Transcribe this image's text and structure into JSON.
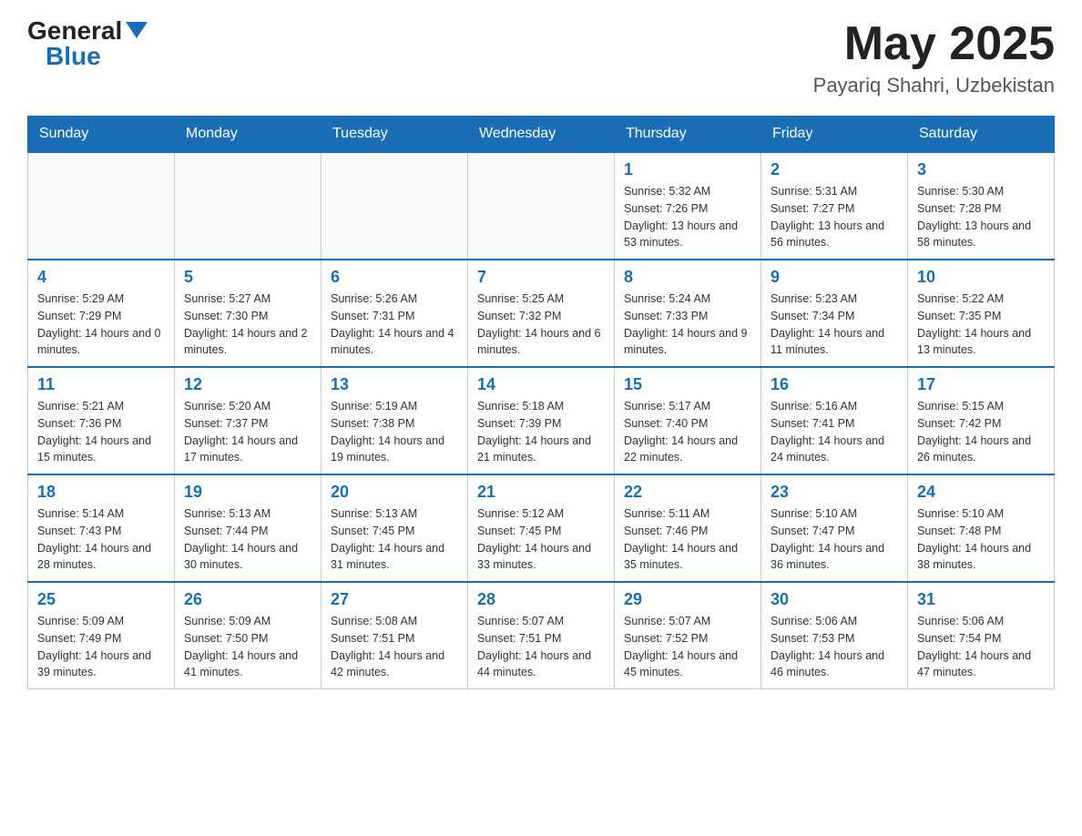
{
  "header": {
    "logo_general": "General",
    "logo_blue": "Blue",
    "month": "May 2025",
    "location": "Payariq Shahri, Uzbekistan"
  },
  "weekdays": [
    "Sunday",
    "Monday",
    "Tuesday",
    "Wednesday",
    "Thursday",
    "Friday",
    "Saturday"
  ],
  "weeks": [
    [
      {
        "day": "",
        "sunrise": "",
        "sunset": "",
        "daylight": ""
      },
      {
        "day": "",
        "sunrise": "",
        "sunset": "",
        "daylight": ""
      },
      {
        "day": "",
        "sunrise": "",
        "sunset": "",
        "daylight": ""
      },
      {
        "day": "",
        "sunrise": "",
        "sunset": "",
        "daylight": ""
      },
      {
        "day": "1",
        "sunrise": "Sunrise: 5:32 AM",
        "sunset": "Sunset: 7:26 PM",
        "daylight": "Daylight: 13 hours and 53 minutes."
      },
      {
        "day": "2",
        "sunrise": "Sunrise: 5:31 AM",
        "sunset": "Sunset: 7:27 PM",
        "daylight": "Daylight: 13 hours and 56 minutes."
      },
      {
        "day": "3",
        "sunrise": "Sunrise: 5:30 AM",
        "sunset": "Sunset: 7:28 PM",
        "daylight": "Daylight: 13 hours and 58 minutes."
      }
    ],
    [
      {
        "day": "4",
        "sunrise": "Sunrise: 5:29 AM",
        "sunset": "Sunset: 7:29 PM",
        "daylight": "Daylight: 14 hours and 0 minutes."
      },
      {
        "day": "5",
        "sunrise": "Sunrise: 5:27 AM",
        "sunset": "Sunset: 7:30 PM",
        "daylight": "Daylight: 14 hours and 2 minutes."
      },
      {
        "day": "6",
        "sunrise": "Sunrise: 5:26 AM",
        "sunset": "Sunset: 7:31 PM",
        "daylight": "Daylight: 14 hours and 4 minutes."
      },
      {
        "day": "7",
        "sunrise": "Sunrise: 5:25 AM",
        "sunset": "Sunset: 7:32 PM",
        "daylight": "Daylight: 14 hours and 6 minutes."
      },
      {
        "day": "8",
        "sunrise": "Sunrise: 5:24 AM",
        "sunset": "Sunset: 7:33 PM",
        "daylight": "Daylight: 14 hours and 9 minutes."
      },
      {
        "day": "9",
        "sunrise": "Sunrise: 5:23 AM",
        "sunset": "Sunset: 7:34 PM",
        "daylight": "Daylight: 14 hours and 11 minutes."
      },
      {
        "day": "10",
        "sunrise": "Sunrise: 5:22 AM",
        "sunset": "Sunset: 7:35 PM",
        "daylight": "Daylight: 14 hours and 13 minutes."
      }
    ],
    [
      {
        "day": "11",
        "sunrise": "Sunrise: 5:21 AM",
        "sunset": "Sunset: 7:36 PM",
        "daylight": "Daylight: 14 hours and 15 minutes."
      },
      {
        "day": "12",
        "sunrise": "Sunrise: 5:20 AM",
        "sunset": "Sunset: 7:37 PM",
        "daylight": "Daylight: 14 hours and 17 minutes."
      },
      {
        "day": "13",
        "sunrise": "Sunrise: 5:19 AM",
        "sunset": "Sunset: 7:38 PM",
        "daylight": "Daylight: 14 hours and 19 minutes."
      },
      {
        "day": "14",
        "sunrise": "Sunrise: 5:18 AM",
        "sunset": "Sunset: 7:39 PM",
        "daylight": "Daylight: 14 hours and 21 minutes."
      },
      {
        "day": "15",
        "sunrise": "Sunrise: 5:17 AM",
        "sunset": "Sunset: 7:40 PM",
        "daylight": "Daylight: 14 hours and 22 minutes."
      },
      {
        "day": "16",
        "sunrise": "Sunrise: 5:16 AM",
        "sunset": "Sunset: 7:41 PM",
        "daylight": "Daylight: 14 hours and 24 minutes."
      },
      {
        "day": "17",
        "sunrise": "Sunrise: 5:15 AM",
        "sunset": "Sunset: 7:42 PM",
        "daylight": "Daylight: 14 hours and 26 minutes."
      }
    ],
    [
      {
        "day": "18",
        "sunrise": "Sunrise: 5:14 AM",
        "sunset": "Sunset: 7:43 PM",
        "daylight": "Daylight: 14 hours and 28 minutes."
      },
      {
        "day": "19",
        "sunrise": "Sunrise: 5:13 AM",
        "sunset": "Sunset: 7:44 PM",
        "daylight": "Daylight: 14 hours and 30 minutes."
      },
      {
        "day": "20",
        "sunrise": "Sunrise: 5:13 AM",
        "sunset": "Sunset: 7:45 PM",
        "daylight": "Daylight: 14 hours and 31 minutes."
      },
      {
        "day": "21",
        "sunrise": "Sunrise: 5:12 AM",
        "sunset": "Sunset: 7:45 PM",
        "daylight": "Daylight: 14 hours and 33 minutes."
      },
      {
        "day": "22",
        "sunrise": "Sunrise: 5:11 AM",
        "sunset": "Sunset: 7:46 PM",
        "daylight": "Daylight: 14 hours and 35 minutes."
      },
      {
        "day": "23",
        "sunrise": "Sunrise: 5:10 AM",
        "sunset": "Sunset: 7:47 PM",
        "daylight": "Daylight: 14 hours and 36 minutes."
      },
      {
        "day": "24",
        "sunrise": "Sunrise: 5:10 AM",
        "sunset": "Sunset: 7:48 PM",
        "daylight": "Daylight: 14 hours and 38 minutes."
      }
    ],
    [
      {
        "day": "25",
        "sunrise": "Sunrise: 5:09 AM",
        "sunset": "Sunset: 7:49 PM",
        "daylight": "Daylight: 14 hours and 39 minutes."
      },
      {
        "day": "26",
        "sunrise": "Sunrise: 5:09 AM",
        "sunset": "Sunset: 7:50 PM",
        "daylight": "Daylight: 14 hours and 41 minutes."
      },
      {
        "day": "27",
        "sunrise": "Sunrise: 5:08 AM",
        "sunset": "Sunset: 7:51 PM",
        "daylight": "Daylight: 14 hours and 42 minutes."
      },
      {
        "day": "28",
        "sunrise": "Sunrise: 5:07 AM",
        "sunset": "Sunset: 7:51 PM",
        "daylight": "Daylight: 14 hours and 44 minutes."
      },
      {
        "day": "29",
        "sunrise": "Sunrise: 5:07 AM",
        "sunset": "Sunset: 7:52 PM",
        "daylight": "Daylight: 14 hours and 45 minutes."
      },
      {
        "day": "30",
        "sunrise": "Sunrise: 5:06 AM",
        "sunset": "Sunset: 7:53 PM",
        "daylight": "Daylight: 14 hours and 46 minutes."
      },
      {
        "day": "31",
        "sunrise": "Sunrise: 5:06 AM",
        "sunset": "Sunset: 7:54 PM",
        "daylight": "Daylight: 14 hours and 47 minutes."
      }
    ]
  ]
}
